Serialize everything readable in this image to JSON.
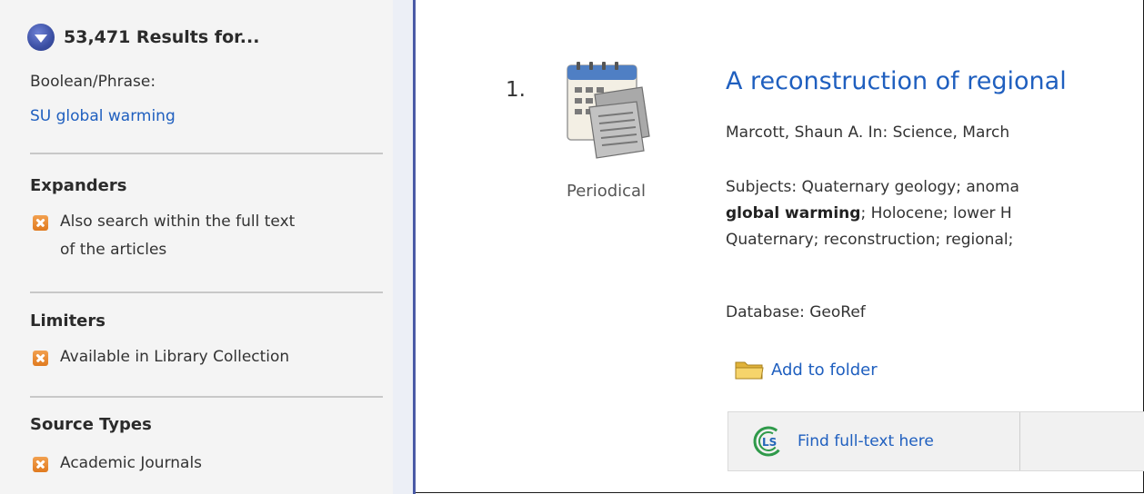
{
  "sidebar": {
    "results_header": "53,471 Results for...",
    "query_type_label": "Boolean/Phrase:",
    "query_value": "SU global warming",
    "sections": {
      "expanders": {
        "title": "Expanders",
        "items": [
          {
            "line1": "Also search within the full text",
            "line2": "of the articles"
          }
        ]
      },
      "limiters": {
        "title": "Limiters",
        "items": [
          {
            "label": "Available in Library Collection"
          }
        ]
      },
      "source_types": {
        "title": "Source Types",
        "items": [
          {
            "label": "Academic Journals"
          }
        ]
      }
    }
  },
  "result": {
    "number": "1.",
    "type_label": "Periodical",
    "title": "A reconstruction of regional",
    "author_source": "Marcott, Shaun A. In: Science, March",
    "subjects": {
      "line1": "Subjects: Quaternary geology; anoma",
      "line2_bold": "global warming",
      "line2_rest": "; Holocene; lower H",
      "line3": "Quaternary; reconstruction; regional;"
    },
    "database": "Database: GeoRef",
    "add_to_folder": "Add to folder",
    "find_fulltext": "Find full-text here"
  },
  "icons": {
    "results_toggle": "chevron-down-icon",
    "remove": "close-icon",
    "periodical": "periodical-icon",
    "folder": "folder-icon",
    "link_source": "ls-logo-icon"
  },
  "colors": {
    "link": "#1f5fbf",
    "accent_blue": "#4a5aa6",
    "remove_orange": "#e8892f",
    "sidebar_bg": "#f4f4f4"
  }
}
